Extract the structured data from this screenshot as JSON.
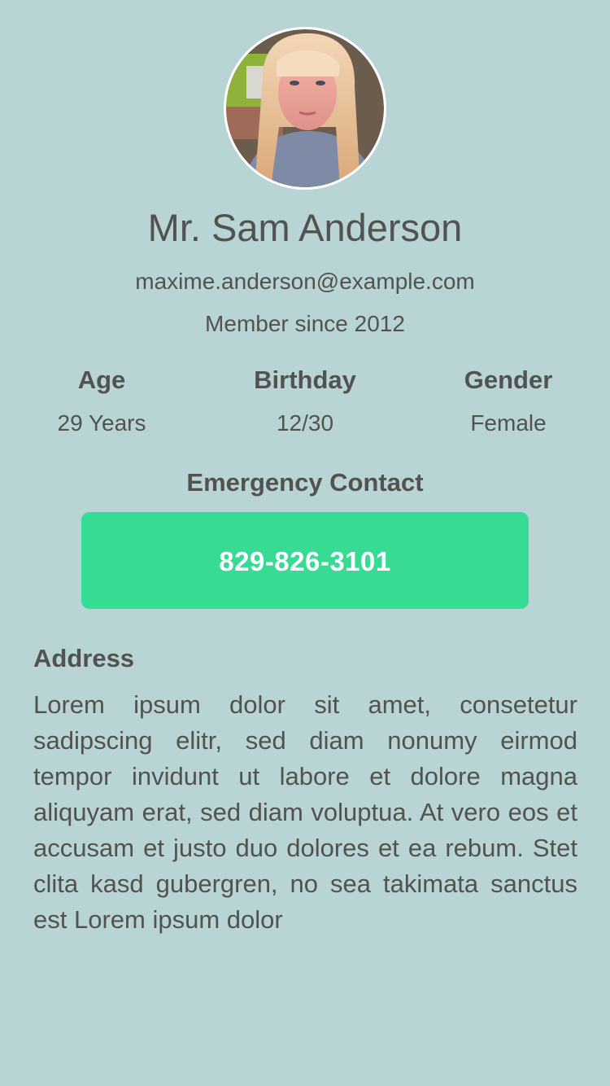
{
  "profile": {
    "avatar_alt": "profile photo",
    "name": "Mr. Sam Anderson",
    "email": "maxime.anderson@example.com",
    "member_since": "Member since 2012"
  },
  "stats": [
    {
      "label": "Age",
      "value": "29 Years"
    },
    {
      "label": "Birthday",
      "value": "12/30"
    },
    {
      "label": "Gender",
      "value": "Female"
    }
  ],
  "emergency": {
    "title": "Emergency Contact",
    "phone": "829-826-3101"
  },
  "address": {
    "title": "Address",
    "text": "Lorem ipsum dolor sit amet, consetetur sadipscing elitr, sed diam nonumy eirmod tempor invidunt ut labore et dolore magna aliquyam erat, sed diam voluptua. At vero eos et accusam et justo duo dolores et ea rebum. Stet clita kasd gubergren, no sea takimata sanctus est Lorem ipsum dolor"
  },
  "colors": {
    "background": "#b9d4d5",
    "text": "#525252",
    "accent": "#38db93",
    "button_text": "#ffffff"
  }
}
